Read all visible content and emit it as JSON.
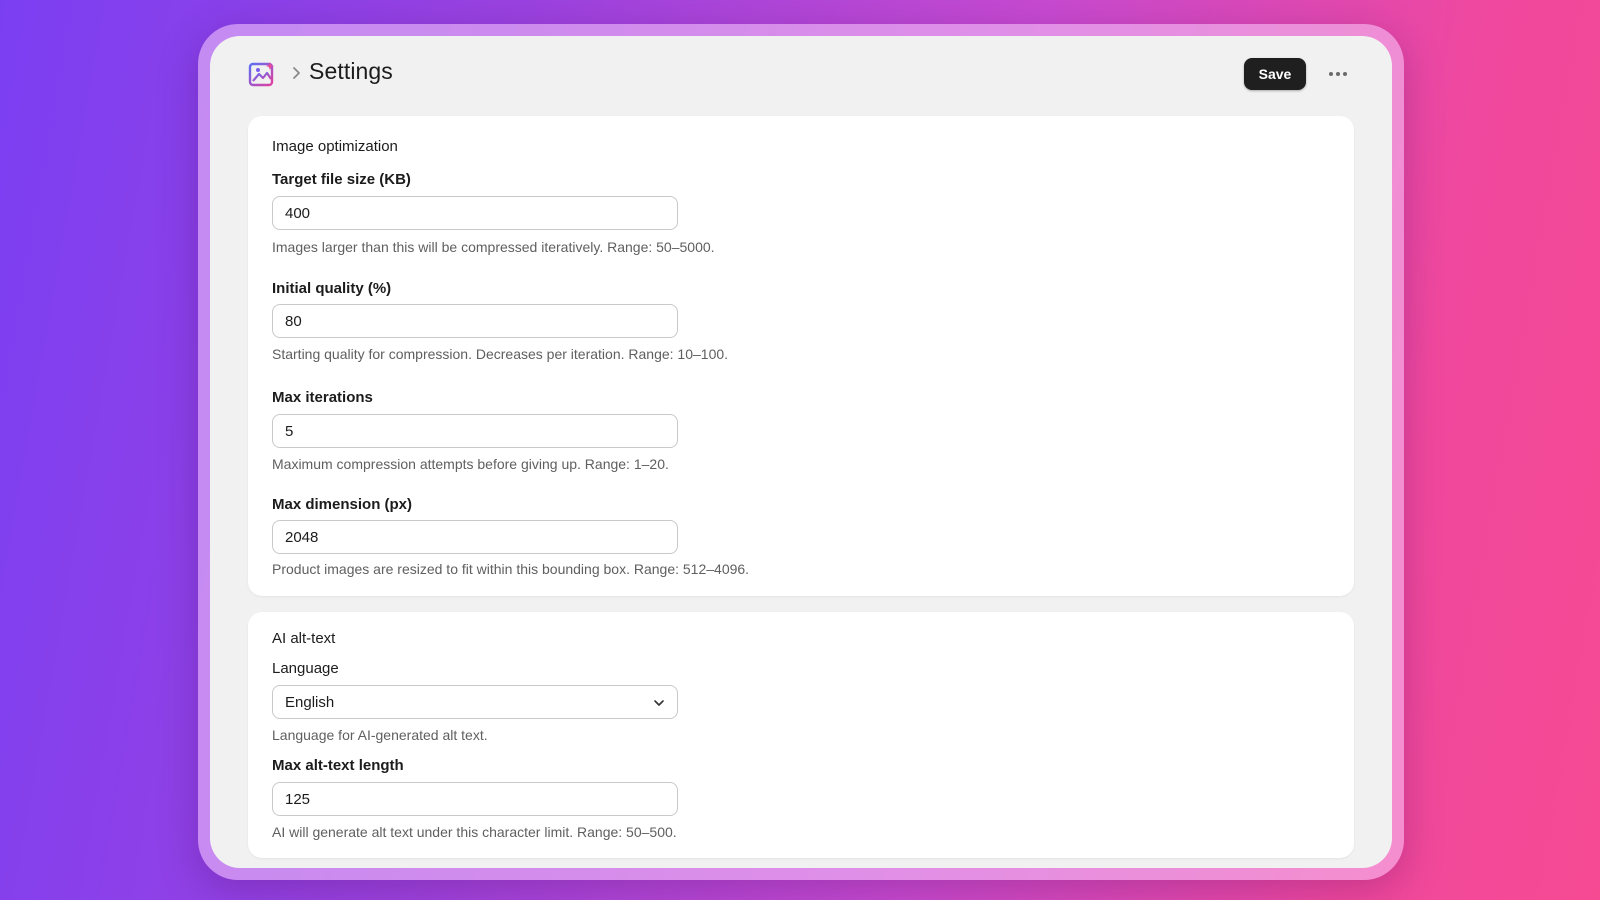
{
  "header": {
    "breadcrumb_icon": "app-image-icon",
    "separator_icon": "chevron-right-icon",
    "title": "Settings",
    "save_label": "Save",
    "more_icon": "more-horizontal-icon"
  },
  "image_optimization": {
    "section_title": "Image optimization",
    "target_file_size": {
      "label": "Target file size (KB)",
      "value": "400",
      "help": "Images larger than this will be compressed iteratively. Range: 50–5000."
    },
    "initial_quality": {
      "label": "Initial quality (%)",
      "value": "80",
      "help": "Starting quality for compression. Decreases per iteration. Range: 10–100."
    },
    "max_iterations": {
      "label": "Max iterations",
      "value": "5",
      "help": "Maximum compression attempts before giving up. Range: 1–20."
    },
    "max_dimension": {
      "label": "Max dimension (px)",
      "value": "2048",
      "help": "Product images are resized to fit within this bounding box. Range: 512–4096."
    }
  },
  "ai_alt_text": {
    "section_title": "AI alt-text",
    "language": {
      "label": "Language",
      "value": "English",
      "help": "Language for AI-generated alt text.",
      "icon": "chevron-down-icon"
    },
    "max_alt_text_length": {
      "label": "Max alt-text length",
      "value": "125",
      "help": "AI will generate alt text under this character limit. Range: 50–500."
    }
  },
  "colors": {
    "primary_button": "#1f1f1f",
    "background_gradient_start": "#7b3ff2",
    "background_gradient_end": "#f64a93",
    "window": "#f1f1f1",
    "card": "#ffffff"
  }
}
